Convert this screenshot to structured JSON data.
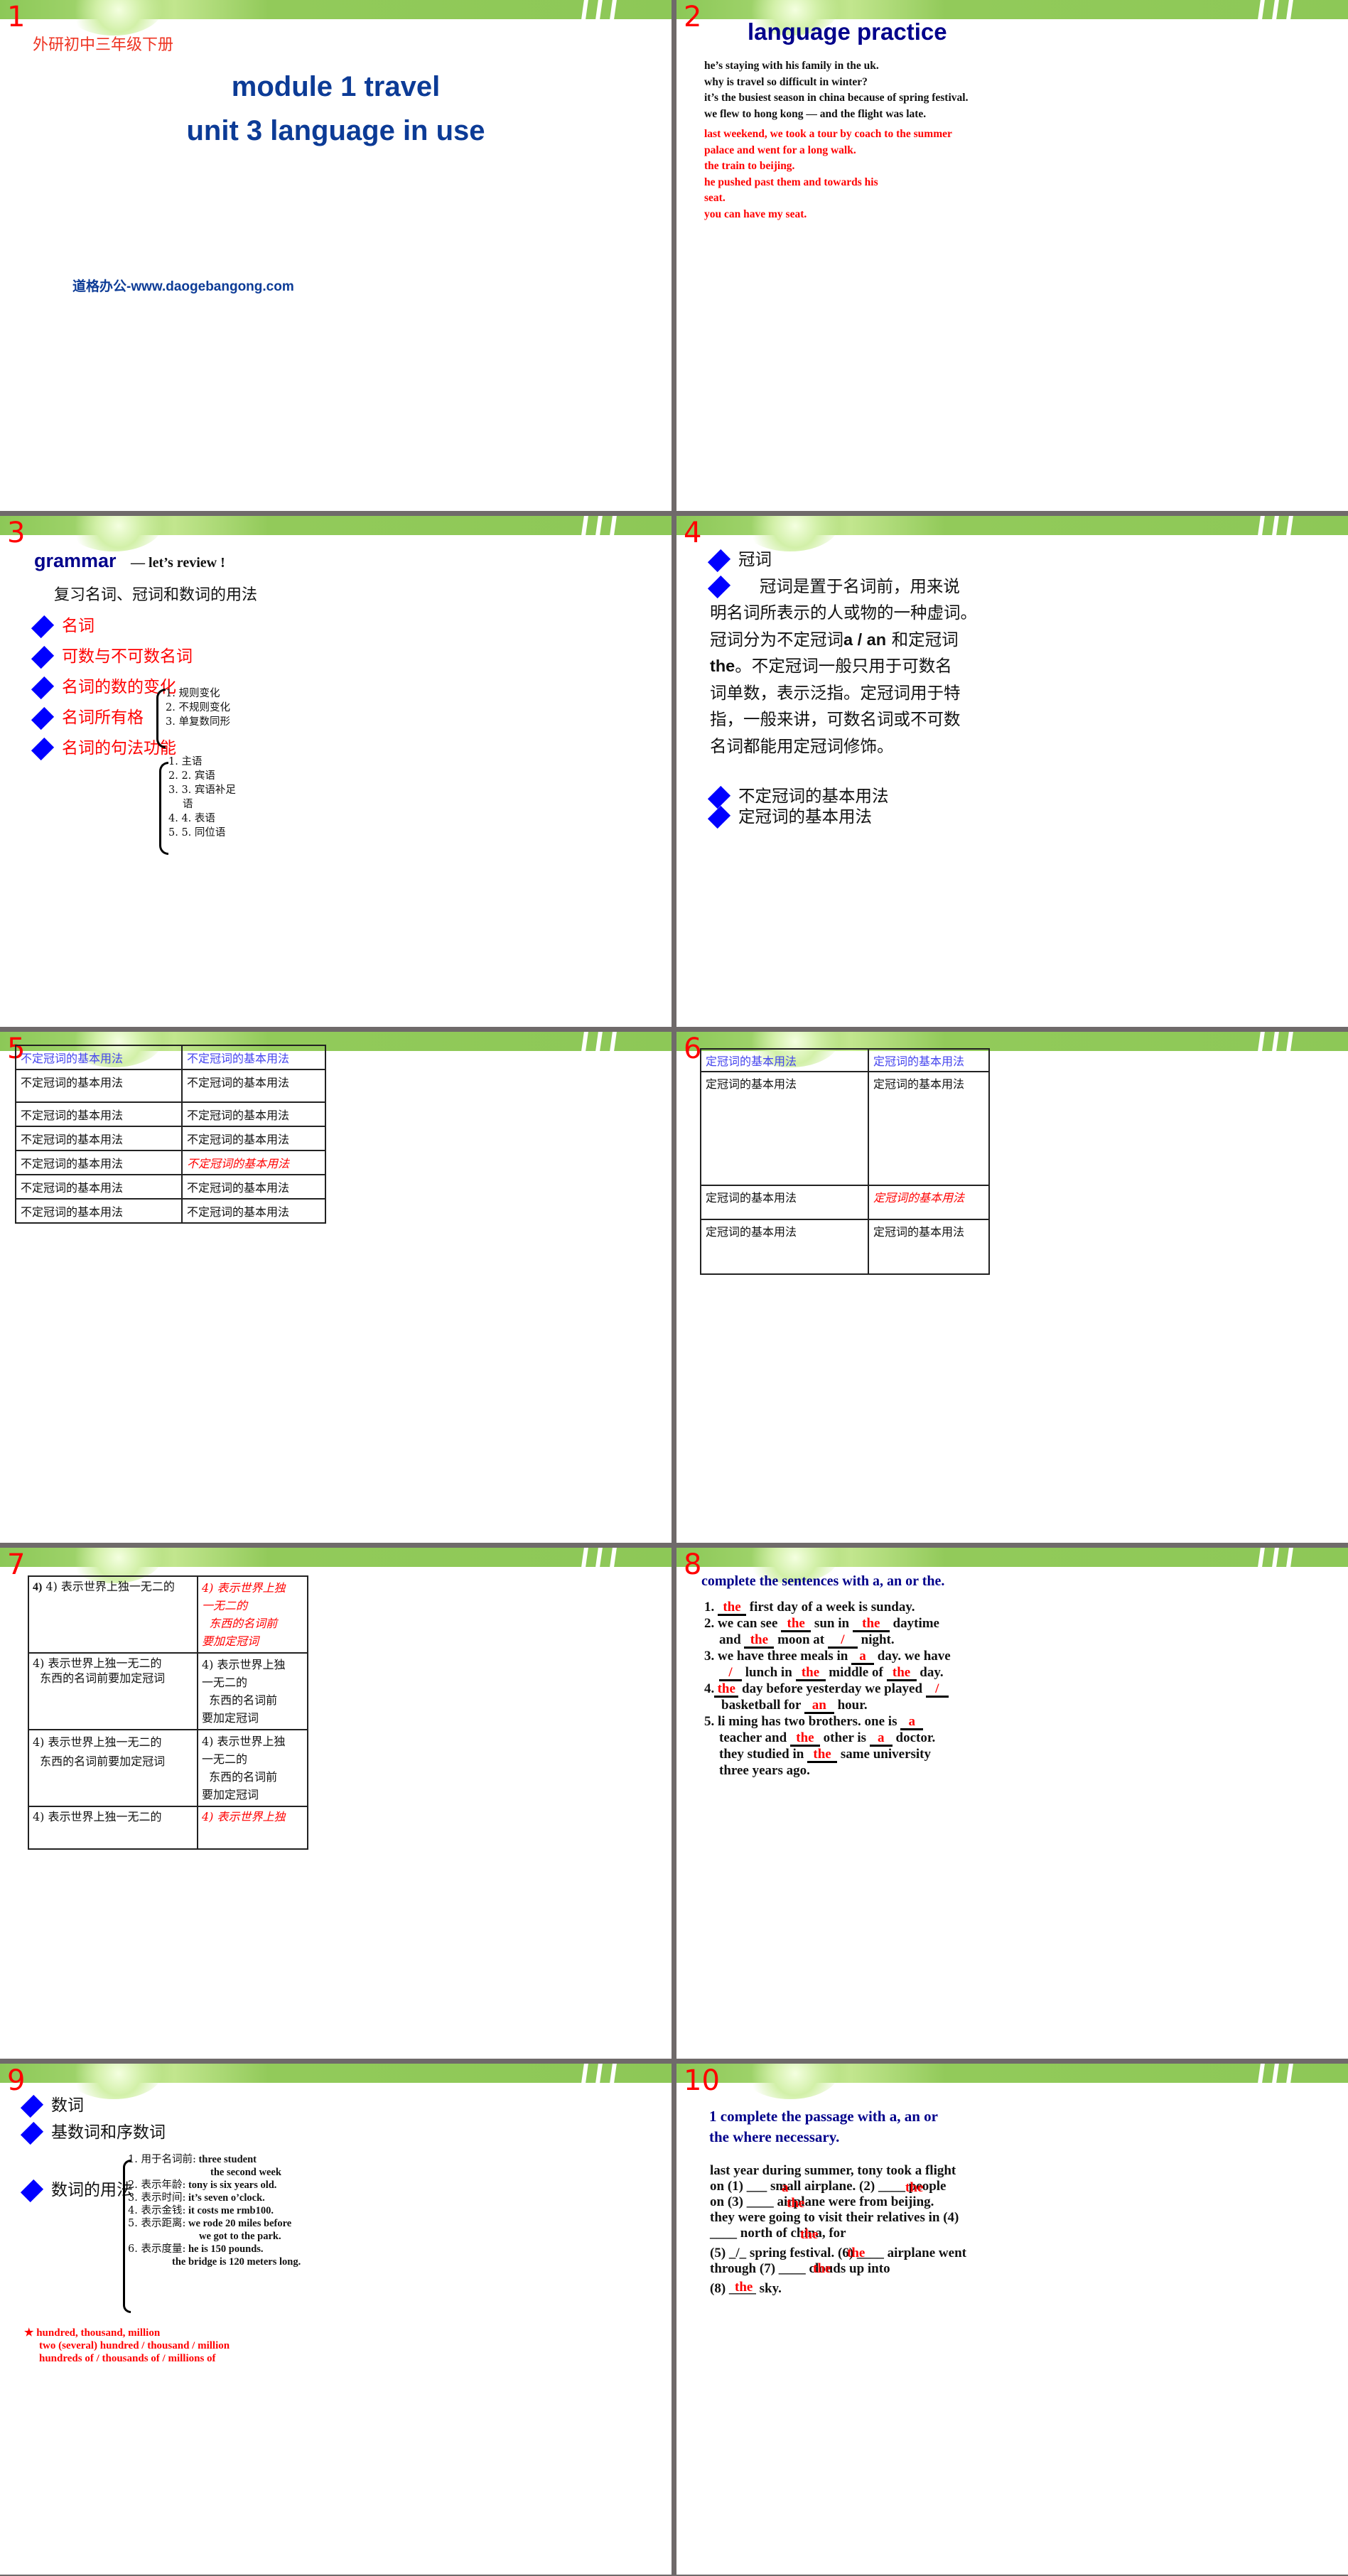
{
  "colors": {
    "band_green": "#8dc857",
    "title_navy": "#0c3b96",
    "heading_dark_blue": "#00008b",
    "answer_red": "#ff0000",
    "bullet_blue": "#0000ff",
    "divider_grey": "#6f6a6a"
  },
  "slides": [
    {
      "number": "1",
      "subtitle": "外研初中三年级下册",
      "title_line1": "module 1  travel",
      "title_line2": "unit 3 language in use",
      "footer": "道格办公-www.daogebangong.com"
    },
    {
      "number": "2",
      "title": "language practice",
      "black_lines": [
        "he’s staying with his family in the uk.",
        "why is travel so difficult in winter?",
        "it’s the busiest season in china because of spring festival.",
        "we flew to hong kong — and the flight was late."
      ],
      "red_lines": [
        "last weekend, we took a tour by coach to the summer",
        "palace and went for a long walk.",
        "the train to beijing.",
        "he pushed past them and towards his",
        "seat.",
        "you can have my seat."
      ]
    },
    {
      "number": "3",
      "title": "grammar",
      "title_suffix": "— let’s review !",
      "subtitle": "复习名词、冠词和数词的用法",
      "bullets": [
        "名词",
        "可数与不可数名词",
        "名词的数的变化",
        "名词所有格",
        "名词的句法功能"
      ],
      "number_changes": [
        "1. 规则变化",
        "2. 不规则变化",
        "3. 单复数同形"
      ],
      "syntax_functions": [
        "1. 主语",
        "2. 2. 宾语",
        "3. 3. 宾语补足",
        "语",
        "4. 4. 表语",
        "5. 5. 同位语"
      ]
    },
    {
      "number": "4",
      "bullet1": "冠词",
      "para_line1": "    冠词是置于名词前，用来说",
      "para_line2": "明名词所表示的人或物的一种虚词。",
      "para_line3_a": "冠词分为不定冠词",
      "para_line3_b": "a / an",
      "para_line3_c": " 和定冠词",
      "para_line4_a": "the",
      "para_line4_b": "。不定冠词一般只用于可数名",
      "para_line5": "词单数，表示泛指。定冠词用于特",
      "para_line6": "指，一般来讲，可数名词或不可数",
      "para_line7": "名词都能用定冠词修饰。",
      "bullet3": "不定冠词的基本用法",
      "bullet4": "定冠词的基本用法"
    },
    {
      "number": "5",
      "table": {
        "header": [
          "不定冠词的基本用法",
          "不定冠词的基本用法"
        ],
        "rows": [
          [
            "不定冠词的基本用法",
            "不定冠词的基本用法"
          ],
          [
            "不定冠词的基本用法",
            "不定冠词的基本用法"
          ],
          [
            "不定冠词的基本用法",
            "不定冠词的基本用法"
          ],
          [
            "不定冠词的基本用法",
            "不定冠词的基本用法"
          ],
          [
            "不定冠词的基本用法",
            "不定冠词的基本用法"
          ],
          [
            "不定冠词的基本用法",
            "不定冠词的基本用法"
          ]
        ]
      }
    },
    {
      "number": "6",
      "table": {
        "header": [
          "定冠词的基本用法",
          "定冠词的基本用法"
        ],
        "rows": [
          [
            "定冠词的基本用法",
            "定冠词的基本用法"
          ],
          [
            "定冠词的基本用法",
            "定冠词的基本用法"
          ],
          [
            "定冠词的基本用法",
            "定冠词的基本用法"
          ]
        ]
      }
    },
    {
      "number": "7",
      "left_line1": "4) 表示世界上独一无二的",
      "left_line2": "东西的名词前要加定冠词",
      "right_line1": "4) 表示世界上独",
      "right_line2": "一无二的",
      "right_line3": "东西的名词前",
      "right_line4": "要加定冠词"
    },
    {
      "number": "8",
      "title": "complete the sentences with a, an or the.",
      "items": [
        {
          "n": "1.",
          "a1": "the",
          "t1": " first day of a week is sunday."
        },
        {
          "n": "2.",
          "t0": " we can see ",
          "a1": "the",
          "t1": " sun in ",
          "a2": "the",
          "t2": " daytime",
          "l2_t0": "and ",
          "l2_a1": "the",
          "l2_t1": " moon at ",
          "l2_a2": "/",
          "l2_t2": " night."
        },
        {
          "n": "3.",
          "t0": " we have three meals in ",
          "a1": "a",
          "t1": " day. we have",
          "l2_a0": "/",
          "l2_t0": " lunch in ",
          "l2_a1": "the",
          "l2_t1": " middle of ",
          "l2_a2": "the",
          "l2_t2": " day."
        },
        {
          "n": "4.",
          "a1": "the",
          "t1": " day before yesterday we played ",
          "a2": "/",
          "l2_t0": "basketball for ",
          "l2_a1": "an",
          "l2_t1": " hour."
        },
        {
          "n": "5.",
          "t0": " li ming has two brothers. one is ",
          "a1": "a",
          "l2_t0": "teacher and ",
          "l2_a1": "the",
          "l2_t1": " other is ",
          "l2_a2": "a",
          "l2_t2": " doctor.",
          "l3_t0": "they studied in ",
          "l3_a1": "the",
          "l3_t1": " same university",
          "l4_t0": "three years ago."
        }
      ]
    },
    {
      "number": "9",
      "bullet1": "数词",
      "bullet2": "基数词和序数词",
      "bullet3": "数词的用法",
      "usages": [
        {
          "label": "1. 用于名词前:",
          "text": " three student"
        },
        {
          "label": "",
          "text": "the second week"
        },
        {
          "label": "2. 表示年龄:",
          "text": " tony is six years old."
        },
        {
          "label": "3. 表示时间:",
          "text": " it’s seven o’clock."
        },
        {
          "label": "4. 表示金钱:",
          "text": " it costs me rmb100."
        },
        {
          "label": "5. 表示距离:",
          "text": " we rode 20 miles before"
        },
        {
          "label": "",
          "text": "we got to the park."
        },
        {
          "label": "6. 表示度量:",
          "text": " he is 150 pounds."
        },
        {
          "label": "",
          "text": "the bridge is 120 meters long."
        }
      ],
      "star": "★",
      "note_lines": [
        "hundred, thousand, million",
        "two (several) hundred / thousand / million",
        "hundreds of / thousands of / millions of"
      ]
    },
    {
      "number": "10",
      "title_line1": "1 complete the passage with a, an or",
      "title_line2": "the where necessary.",
      "lines": [
        "last year during summer, tony took a flight",
        "on (1) ___ small airplane. (2) ____ people",
        "on (3) ____ airplane were from beijing.",
        "they were going to visit their relatives in (4)",
        "____ north of china, for",
        "(5) _/_ spring festival. (6) ____ airplane went",
        "through (7) ____ clouds up into",
        "(8) ____ sky."
      ],
      "answers": [
        "a",
        "the",
        "the",
        "the",
        "/",
        "the",
        "the",
        "the"
      ]
    }
  ]
}
